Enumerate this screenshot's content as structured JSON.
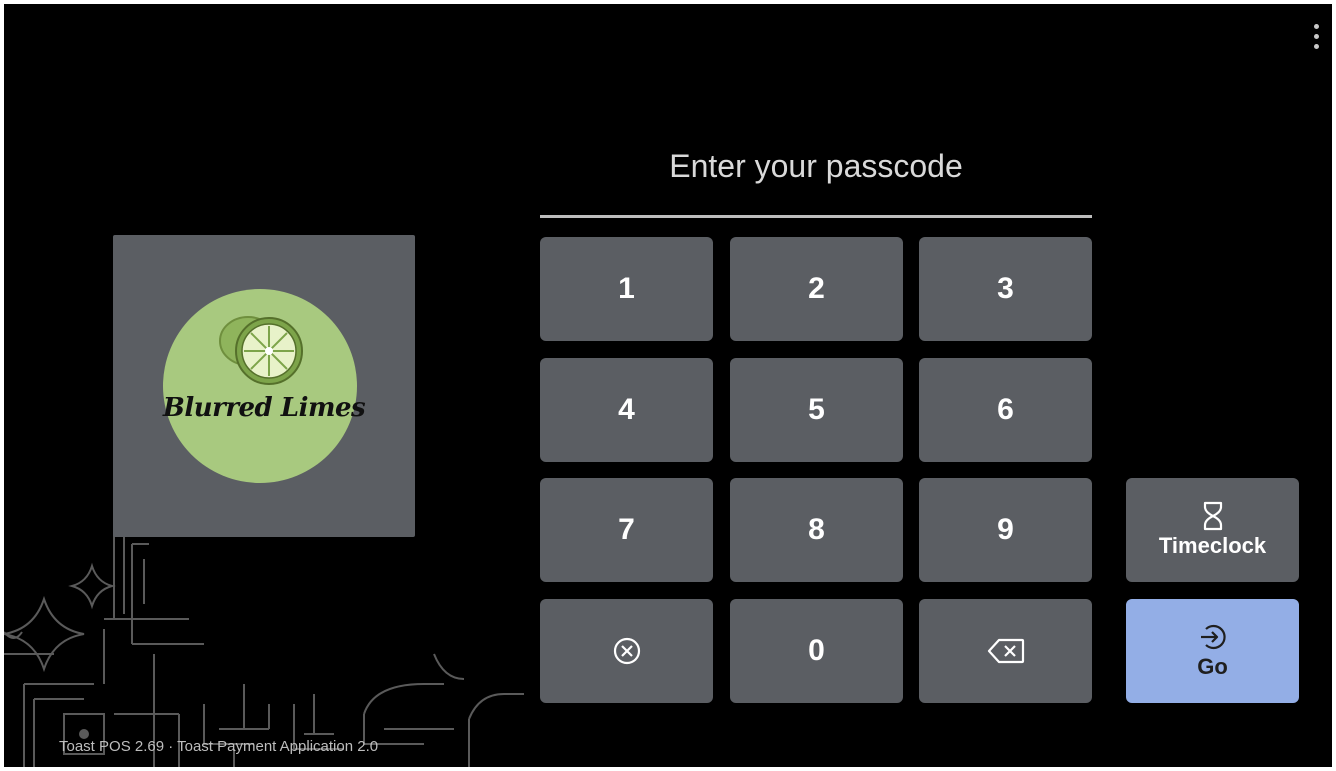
{
  "menu": {
    "icon": "more-vertical-icon"
  },
  "brand": {
    "logo_text": "Blurred Limes",
    "logo_circle_color": "#a8c97f",
    "card_color": "#5b5e63"
  },
  "passcode": {
    "prompt": "Enter your passcode"
  },
  "keypad": {
    "digits": [
      "1",
      "2",
      "3",
      "4",
      "5",
      "6",
      "7",
      "8",
      "9",
      "0"
    ],
    "clear_icon": "circle-x-icon",
    "backspace_icon": "backspace-icon"
  },
  "actions": {
    "timeclock_label": "Timeclock",
    "timeclock_icon": "hourglass-icon",
    "go_label": "Go",
    "go_icon": "login-arrow-icon",
    "go_color": "#93aee6"
  },
  "footer": {
    "version": "Toast POS 2.69 · Toast Payment Application 2.0"
  }
}
